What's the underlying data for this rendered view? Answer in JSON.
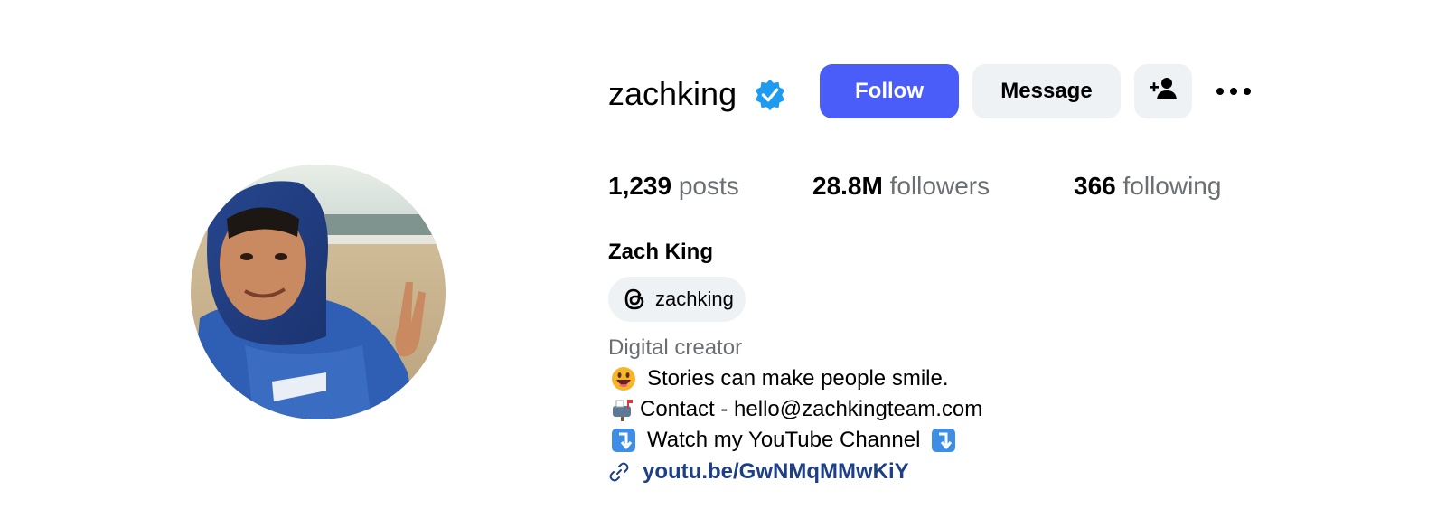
{
  "profile": {
    "username": "zachking",
    "verified": true,
    "full_name": "Zach King",
    "category": "Digital creator"
  },
  "actions": {
    "follow_label": "Follow",
    "message_label": "Message",
    "suggest_icon": "add-person-icon",
    "more_icon": "more-options-icon"
  },
  "stats": {
    "posts_count": "1,239",
    "posts_label": "posts",
    "followers_count": "28.8M",
    "followers_label": "followers",
    "following_count": "366",
    "following_label": "following"
  },
  "threads": {
    "icon": "threads-icon",
    "label": "zachking"
  },
  "bio": {
    "line1_icon": "grinning-face-emoji",
    "line1": "Stories can make people smile.",
    "line2_icon": "mailbox-emoji",
    "line2": "Contact - hello@zachkingteam.com",
    "line3_icon": "down-right-arrow-emoji",
    "line3": "Watch my YouTube Channel"
  },
  "link": {
    "icon": "link-icon",
    "text": "youtu.be/GwNMqMMwKiY"
  },
  "colors": {
    "follow_button": "#4a5df9",
    "secondary_button": "#eff2f5",
    "verified_badge": "#1d9bf0",
    "muted_text": "#6b6e73",
    "link_text": "#1c3f86"
  }
}
